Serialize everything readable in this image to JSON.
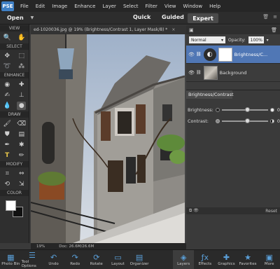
{
  "menubar": {
    "logo": "PSE",
    "items": [
      "File",
      "Edit",
      "Image",
      "Enhance",
      "Layer",
      "Select",
      "Filter",
      "View",
      "Window",
      "Help"
    ]
  },
  "modebar": {
    "open_label": "Open",
    "quick": "Quick",
    "guided": "Guided",
    "expert": "Expert"
  },
  "tools": {
    "view": "VIEW",
    "select": "SELECT",
    "enhance": "ENHANCE",
    "draw": "DRAW",
    "modify": "MODIFY",
    "color": "COLOR"
  },
  "document": {
    "tab_title": "ed-1020036.jpg @ 19% (Brightness/Contrast 1, Layer Mask/8) *",
    "zoom": "19%",
    "doc_size": "Doc: 26.6M/26.6M"
  },
  "layers": {
    "blend_mode": "Normal",
    "opacity_label": "Opacity:",
    "opacity": "100%",
    "items": [
      {
        "name": "Brightness/C..."
      },
      {
        "name": "Background"
      }
    ]
  },
  "adjustment": {
    "title": "Brightness/Contrast",
    "brightness_label": "Brightness:",
    "brightness_value": "0",
    "contrast_label": "Contrast:",
    "contrast_value": "0",
    "reset": "Reset"
  },
  "bottombar": {
    "photo_bin": "Photo Bin",
    "tool_options": "Tool Options",
    "undo": "Undo",
    "redo": "Redo",
    "rotate": "Rotate",
    "layout": "Layout",
    "organizer": "Organizer",
    "layers": "Layers",
    "effects": "Effects",
    "graphics": "Graphics",
    "favorites": "Favorites",
    "more": "More"
  }
}
